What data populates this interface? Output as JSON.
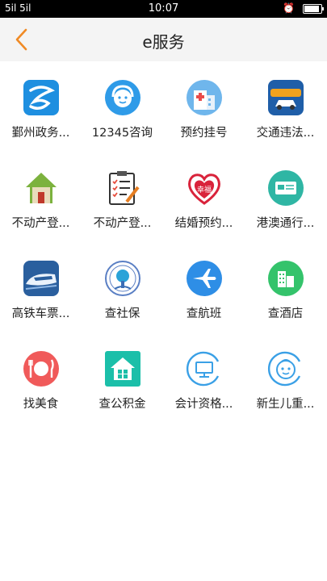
{
  "status": {
    "signal": "5il 5il",
    "time": "10:07"
  },
  "header": {
    "title": "e服务"
  },
  "services": [
    {
      "label": "鄞州政务...",
      "icon": "city-logo-icon"
    },
    {
      "label": "12345咨询",
      "icon": "headset-support-icon"
    },
    {
      "label": "预约挂号",
      "icon": "hospital-icon"
    },
    {
      "label": "交通违法...",
      "icon": "car-violation-query-icon"
    },
    {
      "label": "不动产登...",
      "icon": "house-icon"
    },
    {
      "label": "不动产登...",
      "icon": "clipboard-checklist-icon"
    },
    {
      "label": "结婚预约...",
      "icon": "heart-happiness-icon"
    },
    {
      "label": "港澳通行...",
      "icon": "pass-card-icon"
    },
    {
      "label": "高铁车票...",
      "icon": "high-speed-train-icon"
    },
    {
      "label": "查社保",
      "icon": "social-security-seal-icon"
    },
    {
      "label": "查航班",
      "icon": "airplane-icon"
    },
    {
      "label": "查酒店",
      "icon": "hotel-building-icon"
    },
    {
      "label": "找美食",
      "icon": "plate-fork-knife-icon"
    },
    {
      "label": "查公积金",
      "icon": "provident-fund-house-icon"
    },
    {
      "label": "会计资格...",
      "icon": "monitor-icon"
    },
    {
      "label": "新生儿重...",
      "icon": "baby-face-icon"
    }
  ],
  "colors": {
    "accent": "#f08a24",
    "nav_bg": "#f4f4f4"
  }
}
